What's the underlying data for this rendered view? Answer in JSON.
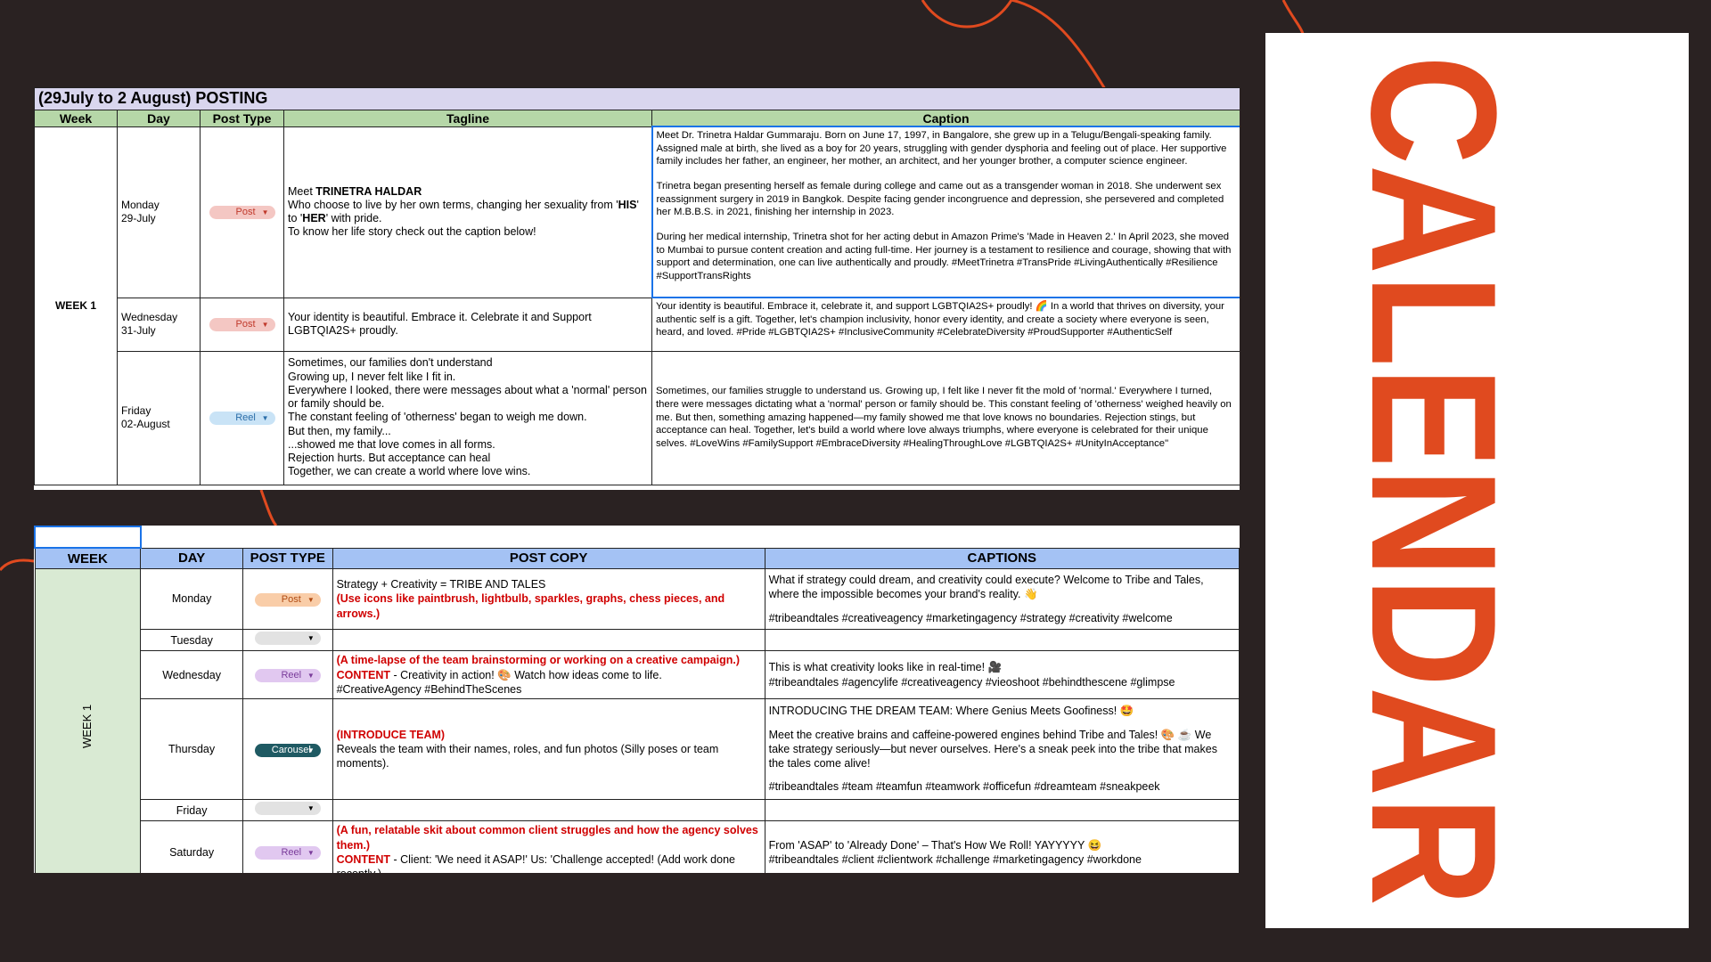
{
  "colors": {
    "background": "#2a2222",
    "accent_orange": "#e04a1f",
    "header_green": "#b6d7a8",
    "header_blue": "#a4c2f4",
    "title_lavender": "#d9d6ee"
  },
  "calendar_title": "CALENDAR",
  "sheet1": {
    "title": "(29July to 2 August) POSTING",
    "headers": [
      "Week",
      "Day",
      "Post Type",
      "Tagline",
      "Caption"
    ],
    "week_label": "WEEK 1",
    "rows": [
      {
        "day_line1": "Monday",
        "day_line2": "29-July",
        "post_type": "Post",
        "tagline_p1": "Meet ",
        "tagline_bold1": "TRINETRA HALDAR",
        "tagline_p2": "Who choose to live by her own terms, changing her sexuality from '",
        "tagline_bold2": "HIS",
        "tagline_p3": "' to '",
        "tagline_bold3": "HER",
        "tagline_p4": "' with pride.",
        "tagline_p5": "To know her life story check out the caption below!",
        "caption_para1": "Meet Dr. Trinetra Haldar Gummaraju. Born on June 17, 1997, in Bangalore, she grew up in a Telugu/Bengali-speaking family. Assigned male at birth, she lived as a boy for 20 years, struggling with gender dysphoria and feeling out of place. Her supportive family includes her father, an engineer, her mother, an architect, and her younger brother, a computer science engineer.",
        "caption_para2": "Trinetra began presenting herself as female during college and came out as a transgender woman in 2018. She underwent sex reassignment surgery in 2019 in Bangkok. Despite facing gender incongruence and depression, she persevered and completed her M.B.B.S. in 2021, finishing her internship in 2023.",
        "caption_para3": "During her medical internship, Trinetra shot for her acting debut in Amazon Prime's 'Made in Heaven 2.' In April 2023, she moved to Mumbai to pursue content creation and acting full-time. Her journey is a testament to resilience and courage, showing that with support and determination, one can live authentically and proudly. #MeetTrinetra #TransPride #LivingAuthentically #Resilience #SupportTransRights"
      },
      {
        "day_line1": "Wednesday",
        "day_line2": "31-July",
        "post_type": "Post",
        "tagline": "Your identity is beautiful. Embrace it. Celebrate it and Support LGBTQIA2S+ proudly.",
        "caption": "Your identity is beautiful. Embrace it, celebrate it, and support LGBTQIA2S+ proudly! 🌈 In a world that thrives on diversity, your authentic self is a gift. Together, let's champion inclusivity, honor every identity, and create a society where everyone is seen, heard, and loved. #Pride #LGBTQIA2S+ #InclusiveCommunity #CelebrateDiversity #ProudSupporter #AuthenticSelf"
      },
      {
        "day_line1": "Friday",
        "day_line2": "02-August",
        "post_type": "Reel",
        "tagline_lines": [
          "Sometimes, our families don't understand",
          "Growing up, I never felt like I fit in.",
          "Everywhere I looked, there were messages about what a 'normal' person or family should be.",
          "The constant feeling of 'otherness' began to weigh me down.",
          "But then, my family...",
          "...showed me that love comes in all forms.",
          "Rejection hurts. But acceptance can heal",
          "Together, we can create a world where love wins."
        ],
        "caption": "Sometimes, our families struggle to understand us. Growing up, I felt like I never fit the mold of 'normal.' Everywhere I turned, there were messages dictating what a 'normal' person or family should be. This constant feeling of 'otherness' weighed heavily on me. But then, something amazing happened—my family showed me that love knows no boundaries. Rejection stings, but acceptance can heal. Together, let's build a world where love always triumphs, where everyone is celebrated for their unique selves. #LoveWins #FamilySupport #EmbraceDiversity #HealingThroughLove #LGBTQIA2S+ #UnityInAcceptance\""
      }
    ]
  },
  "sheet2": {
    "headers": [
      "WEEK",
      "DAY",
      "POST TYPE",
      "POST COPY",
      "CAPTIONS"
    ],
    "week_label": "WEEK 1",
    "rows": [
      {
        "day": "Monday",
        "post_type": "Post",
        "copy_plain": "Strategy + Creativity = TRIBE AND TALES",
        "copy_red": "(Use icons like paintbrush, lightbulb, sparkles, graphs, chess pieces, and arrows.)",
        "caption_line1": "What if strategy could dream, and creativity could execute? Welcome to Tribe and Tales, where the impossible becomes your brand's reality. 👋",
        "caption_line2": "#tribeandtales #creativeagency #marketingagency #strategy #creativity #welcome"
      },
      {
        "day": "Tuesday",
        "post_type": ""
      },
      {
        "day": "Wednesday",
        "post_type": "Reel",
        "copy_red": "(A time-lapse of the team brainstorming or working on a creative campaign.)",
        "copy_label": "CONTENT",
        "copy_rest": " - Creativity in action! 🎨 Watch how ideas come to life.",
        "copy_tags": "#CreativeAgency #BehindTheScenes",
        "caption_line1": "This is what creativity looks like in real-time! 🎥",
        "caption_line2": "#tribeandtales #agencylife #creativeagency #vieoshoot #behindthescene #glimpse"
      },
      {
        "day": "Thursday",
        "post_type": "Carousel",
        "copy_red": "(INTRODUCE TEAM)",
        "copy_plain": "Reveals the team with their names, roles, and fun photos (Silly poses or team moments).",
        "caption_line1": "INTRODUCING THE DREAM TEAM: Where Genius Meets Goofiness! 🤩",
        "caption_line2": "Meet the creative brains and caffeine-powered engines behind Tribe and Tales! 🎨 ☕ We take strategy seriously—but never ourselves. Here's a sneak peek into the tribe that makes the tales come alive!",
        "caption_line3": "#tribeandtales #team #teamfun #teamwork #officefun #dreamteam #sneakpeek"
      },
      {
        "day": "Friday",
        "post_type": ""
      },
      {
        "day": "Saturday",
        "post_type": "Reel",
        "copy_red": "(A fun, relatable skit about common client struggles and how the agency solves them.)",
        "copy_label": "CONTENT",
        "copy_rest": " - Client: 'We need it ASAP!' Us: 'Challenge accepted! (Add work done recently.)",
        "caption_line1": "From 'ASAP' to 'Already Done' – That's How We Roll! YAYYYYY 😆",
        "caption_line2": "#tribeandtales #client #clientwork #challenge #marketingagency #workdone"
      }
    ]
  },
  "icons": {
    "dropdown": "dropdown-arrow-icon"
  }
}
